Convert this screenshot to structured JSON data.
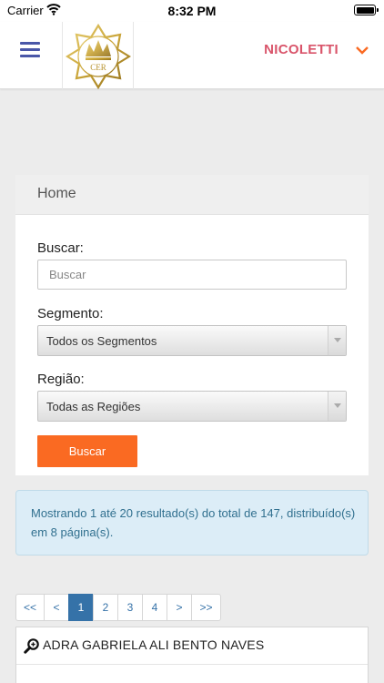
{
  "status_bar": {
    "carrier": "Carrier",
    "time": "8:32 PM",
    "wifi_icon": "wifi-icon",
    "battery_icon": "battery-icon"
  },
  "header": {
    "menu_icon": "hamburger-menu-icon",
    "logo_text": "CER",
    "user_name": "NICOLETTI",
    "chevron_icon": "chevron-down-icon"
  },
  "panel": {
    "title": "Home",
    "search": {
      "label": "Buscar:",
      "placeholder": "Buscar",
      "value": ""
    },
    "segment": {
      "label": "Segmento:",
      "selected": "Todos os Segmentos"
    },
    "region": {
      "label": "Região:",
      "selected": "Todas as Regiões"
    },
    "search_button": "Buscar"
  },
  "results_info": "Mostrando 1 até 20 resultado(s) do total de 147, distribuído(s) em 8 página(s).",
  "pagination": {
    "first": "<<",
    "prev": "<",
    "pages": [
      "1",
      "2",
      "3",
      "4"
    ],
    "active_page": "1",
    "next": ">",
    "last": ">>"
  },
  "results": [
    {
      "name": "ADRA GABRIELA ALI BENTO NAVES",
      "icon": "magnifier-icon"
    }
  ],
  "colors": {
    "accent": "#fa6a22",
    "brand_blue": "#4a57a8",
    "user_name": "#d9546a",
    "link": "#3572a8",
    "alert_bg": "#dcedf7",
    "logo_gold": "#c9a437"
  }
}
